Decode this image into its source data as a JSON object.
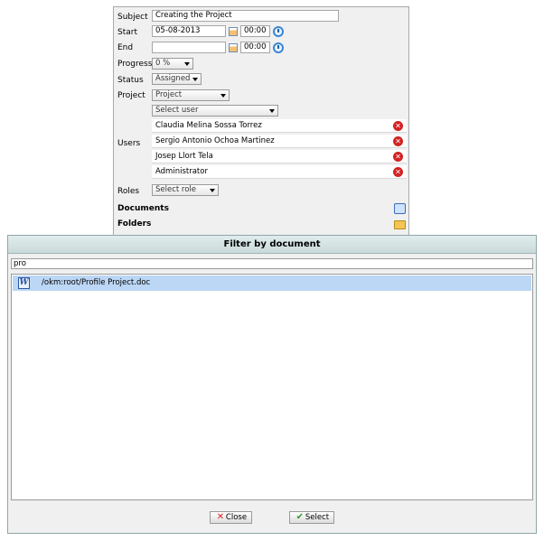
{
  "task_form": {
    "subject_label": "Subject",
    "subject_value": "Creating the Project",
    "start_label": "Start",
    "start_date": "05-08-2013",
    "start_time": "00:00",
    "end_label": "End",
    "end_date": "",
    "end_time": "00:00",
    "progress_label": "Progress",
    "progress_value": "0  %",
    "status_label": "Status",
    "status_value": "Assigned",
    "project_label": "Project",
    "project_value": "Project",
    "users_label": "Users",
    "select_user_placeholder": "Select user",
    "users": [
      "Claudia Melina Sossa Torrez",
      "Sergio Antonio Ochoa Martinez",
      "Josep Llort Tela",
      "Administrator"
    ],
    "roles_label": "Roles",
    "roles_value": "Select role",
    "documents_label": "Documents",
    "folders_label": "Folders"
  },
  "filter_dialog": {
    "title": "Filter by document",
    "filter_value": "pro",
    "results": [
      {
        "icon": "W",
        "path": "/okm:root/Profile Project.doc"
      }
    ],
    "close_label": "Close",
    "select_label": "Select"
  },
  "icons": {
    "calendar": "calendar-icon",
    "clock": "clock-icon",
    "remove": "remove-icon",
    "add_document": "add-document-icon",
    "add_folder": "add-folder-icon",
    "word_document": "word-document-icon"
  },
  "colors": {
    "selected_row": "#bcd6f5",
    "remove_red": "#d32222",
    "select_green": "#2f9a2f"
  }
}
